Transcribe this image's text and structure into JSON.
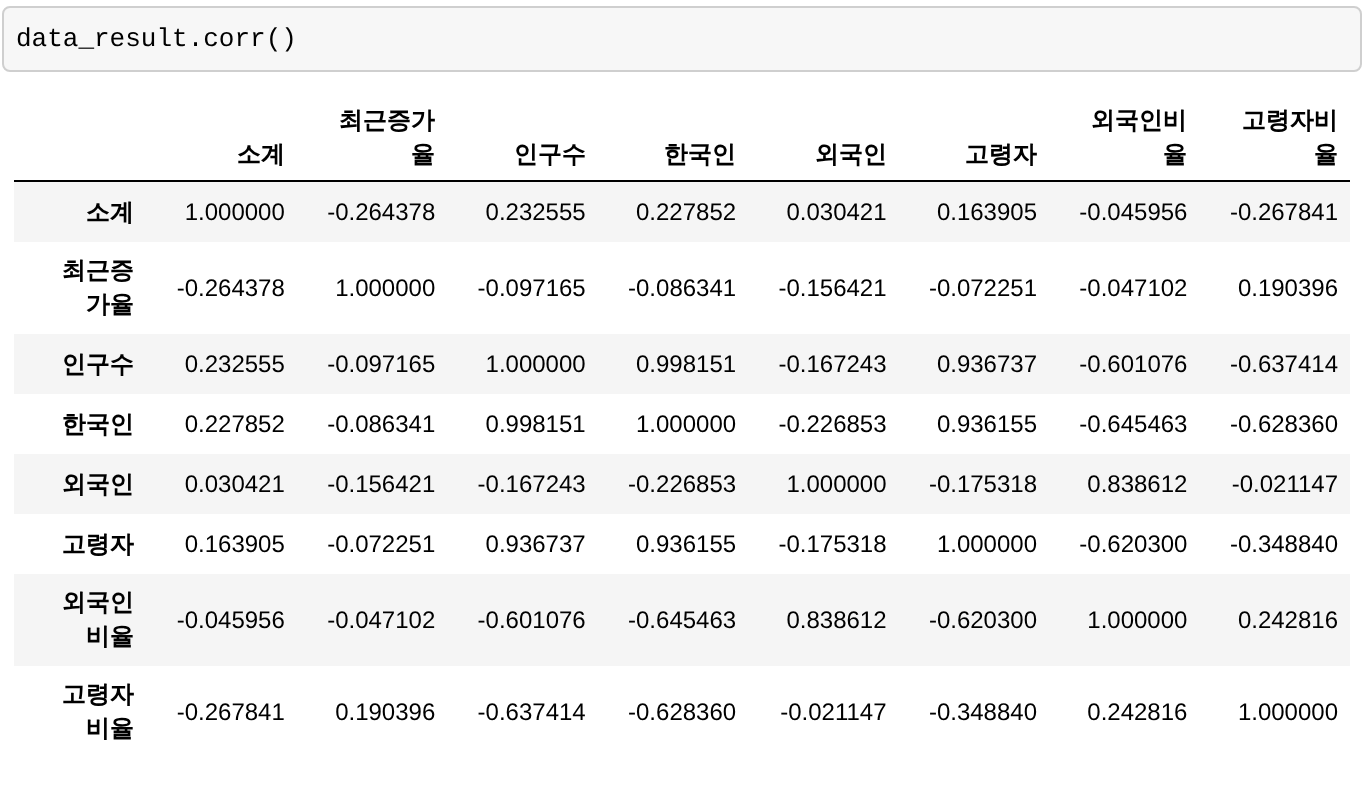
{
  "input_cell": {
    "code": "data_result.corr()"
  },
  "table": {
    "columns": [
      "소계",
      "최근증가율",
      "인구수",
      "한국인",
      "외국인",
      "고령자",
      "외국인비율",
      "고령자비율"
    ],
    "rows": [
      {
        "index": "소계",
        "cells": [
          "1.000000",
          "-0.264378",
          "0.232555",
          "0.227852",
          "0.030421",
          "0.163905",
          "-0.045956",
          "-0.267841"
        ]
      },
      {
        "index": "최근증가율",
        "cells": [
          "-0.264378",
          "1.000000",
          "-0.097165",
          "-0.086341",
          "-0.156421",
          "-0.072251",
          "-0.047102",
          "0.190396"
        ]
      },
      {
        "index": "인구수",
        "cells": [
          "0.232555",
          "-0.097165",
          "1.000000",
          "0.998151",
          "-0.167243",
          "0.936737",
          "-0.601076",
          "-0.637414"
        ]
      },
      {
        "index": "한국인",
        "cells": [
          "0.227852",
          "-0.086341",
          "0.998151",
          "1.000000",
          "-0.226853",
          "0.936155",
          "-0.645463",
          "-0.628360"
        ]
      },
      {
        "index": "외국인",
        "cells": [
          "0.030421",
          "-0.156421",
          "-0.167243",
          "-0.226853",
          "1.000000",
          "-0.175318",
          "0.838612",
          "-0.021147"
        ]
      },
      {
        "index": "고령자",
        "cells": [
          "0.163905",
          "-0.072251",
          "0.936737",
          "0.936155",
          "-0.175318",
          "1.000000",
          "-0.620300",
          "-0.348840"
        ]
      },
      {
        "index": "외국인비율",
        "cells": [
          "-0.045956",
          "-0.047102",
          "-0.601076",
          "-0.645463",
          "0.838612",
          "-0.620300",
          "1.000000",
          "0.242816"
        ]
      },
      {
        "index": "고령자비율",
        "cells": [
          "-0.267841",
          "0.190396",
          "-0.637414",
          "-0.628360",
          "-0.021147",
          "-0.348840",
          "0.242816",
          "1.000000"
        ]
      }
    ]
  }
}
